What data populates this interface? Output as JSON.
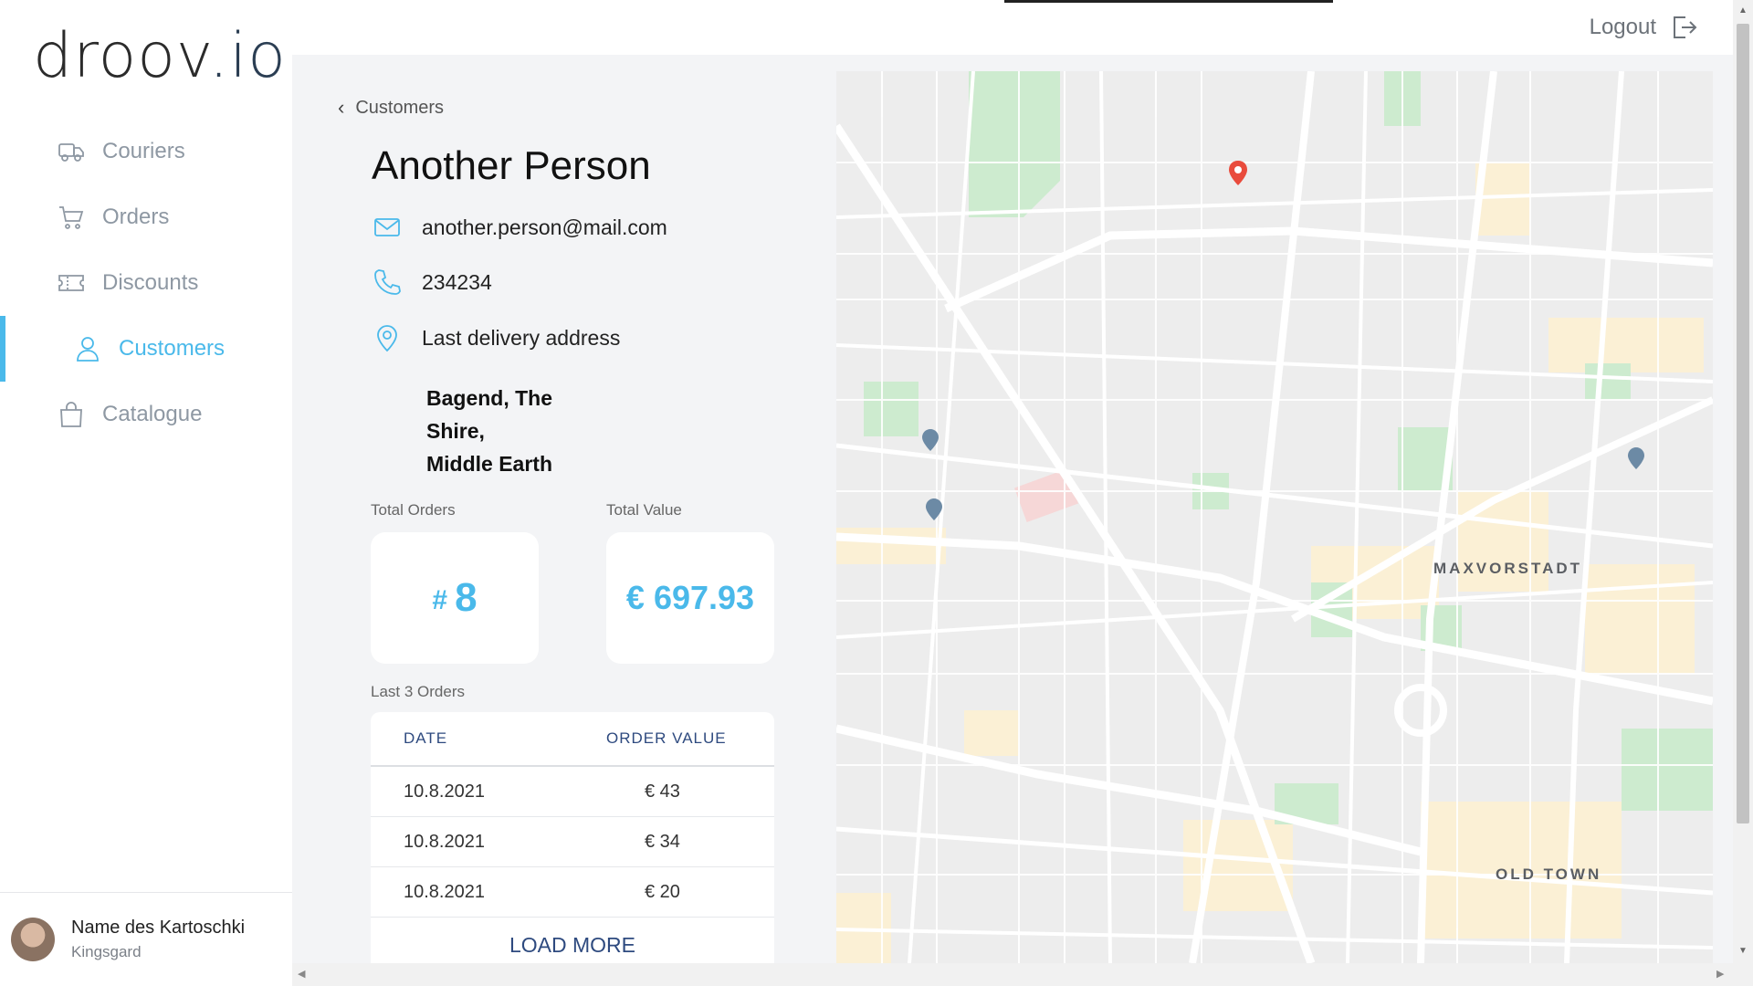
{
  "app": {
    "logo_main": "droov",
    "logo_tld": ".io"
  },
  "sidebar": {
    "items": [
      {
        "label": "Couriers",
        "icon": "truck-icon"
      },
      {
        "label": "Orders",
        "icon": "cart-icon"
      },
      {
        "label": "Discounts",
        "icon": "ticket-icon"
      },
      {
        "label": "Customers",
        "icon": "user-icon",
        "active": true
      },
      {
        "label": "Catalogue",
        "icon": "bag-icon"
      }
    ]
  },
  "user": {
    "name": "Name des Kartoschki",
    "subtitle": "Kingsgard"
  },
  "topbar": {
    "logout_label": "Logout"
  },
  "customer": {
    "back_label": "Customers",
    "name": "Another Person",
    "email": "another.person@mail.com",
    "phone": "234234",
    "address_label": "Last delivery address",
    "address_lines": [
      "Bagend, The",
      "Shire,",
      "Middle Earth"
    ]
  },
  "stats": {
    "total_orders_label": "Total Orders",
    "total_orders_prefix": "#",
    "total_orders_value": "8",
    "total_value_label": "Total Value",
    "total_value_value": "€ 697.93"
  },
  "orders": {
    "section_label": "Last 3 Orders",
    "columns": [
      "DATE",
      "ORDER VALUE"
    ],
    "rows": [
      {
        "date": "10.8.2021",
        "value": "€ 43"
      },
      {
        "date": "10.8.2021",
        "value": "€ 34"
      },
      {
        "date": "10.8.2021",
        "value": "€ 20"
      }
    ],
    "load_more_label": "LOAD MORE"
  },
  "map": {
    "labels": [
      "MAXVORSTADT",
      "OLD TOWN"
    ]
  },
  "colors": {
    "accent": "#4ab9ea",
    "navy": "#2e4a7f",
    "panel_bg": "#f3f4f6"
  }
}
